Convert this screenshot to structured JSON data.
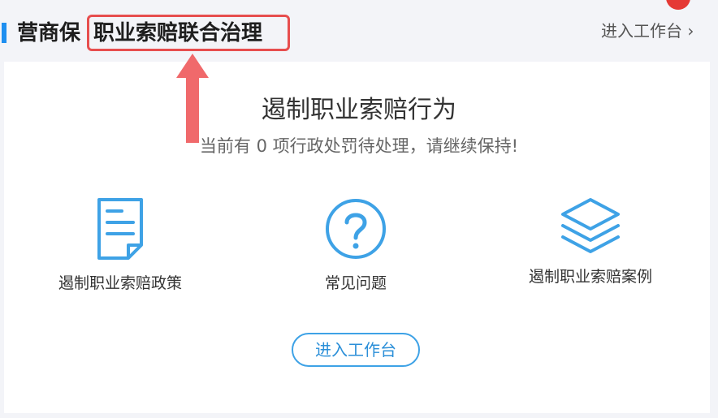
{
  "header": {
    "brand": "营商保",
    "subtitle": "职业索赔联合治理",
    "workbench_link": "进入工作台",
    "link_arrow": "›"
  },
  "main": {
    "title": "遏制职业索赔行为",
    "description": "当前有 0 项行政处罚待处理，请继续保持!",
    "pending_count": 0
  },
  "features": [
    {
      "label": "遏制职业索赔政策",
      "icon": "document-icon"
    },
    {
      "label": "常见问题",
      "icon": "question-circle-icon"
    },
    {
      "label": "遏制职业索赔案例",
      "icon": "layers-icon"
    }
  ],
  "cta": {
    "label": "进入工作台"
  },
  "colors": {
    "accent": "#1e8ff0",
    "icon": "#3ea2e6",
    "highlight_border": "#e74e4e",
    "annotation_arrow": "#f0696b"
  }
}
